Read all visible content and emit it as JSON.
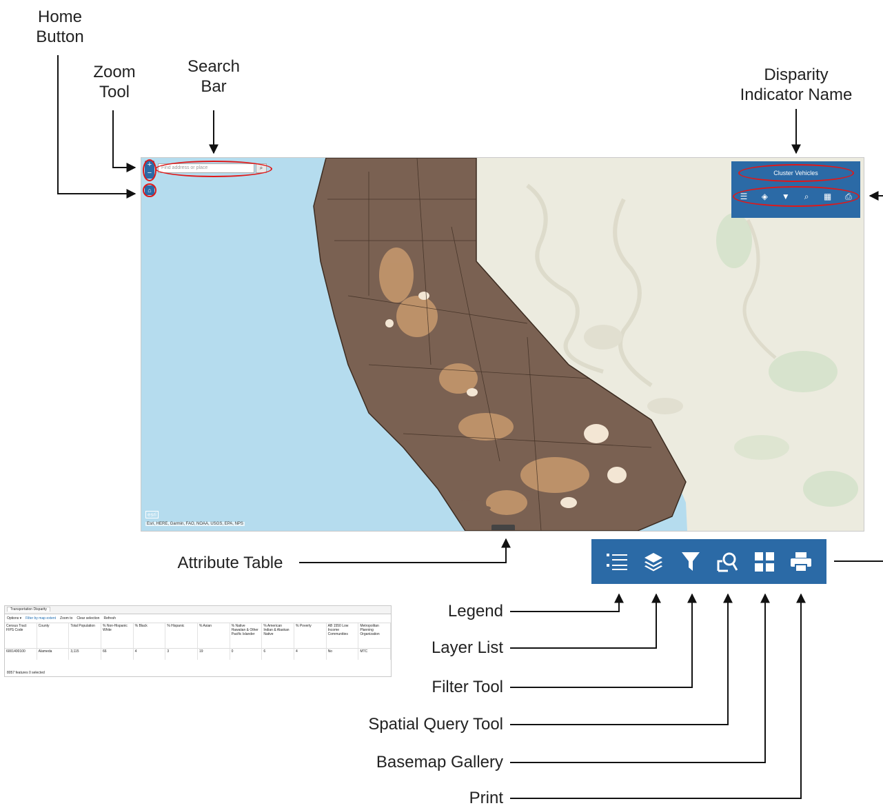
{
  "callouts": {
    "home_button": "Home\nButton",
    "zoom_tool": "Zoom\nTool",
    "search_bar": "Search\nBar",
    "disparity_indicator_name": "Disparity\nIndicator Name",
    "attribute_table": "Attribute Table",
    "legend": "Legend",
    "layer_list": "Layer List",
    "filter_tool": "Filter Tool",
    "spatial_query_tool": "Spatial Query Tool",
    "basemap_gallery": "Basemap Gallery",
    "print": "Print"
  },
  "map": {
    "search_placeholder": "Find address or place",
    "zoom_label": "+\n−",
    "indicator_name": "Cluster Vehicles",
    "attribution": "Esri, HERE, Garmin, FAO, NOAA, USGS, EPA, NPS",
    "logo_text": "esri",
    "colors": {
      "ocean": "#b5dcee",
      "california": "#7a6152",
      "nevada": "#ecebdf",
      "panel": "#2b6aa6",
      "highlight_ring": "#e01818"
    }
  },
  "toolbar_icons": [
    "legend-icon",
    "layer-list-icon",
    "filter-icon",
    "spatial-query-icon",
    "basemap-gallery-icon",
    "print-icon"
  ],
  "attribute_table": {
    "tab_label": "Transportation Disparity",
    "options_label": "Options ▾",
    "filter_label": "Filter by map extent",
    "zoom_label": "Zoom to",
    "clear_label": "Clear selection",
    "refresh_label": "Refresh",
    "columns": [
      "Census Tract FIPS Code",
      "County",
      "Total Population",
      "% Non-Hispanic White",
      "% Black",
      "% Hispanic",
      "% Asian",
      "% Native Hawaiian & Other Pacific Islander",
      "% American Indian & Alaskan Native",
      "% Poverty",
      "AB 1550 Low Income Communities",
      "Metropolitan Planning Organization"
    ],
    "row": [
      "6001400100",
      "Alameda",
      "3,115",
      "66",
      "4",
      "3",
      "19",
      "0",
      "6",
      "4",
      "No",
      "MTC"
    ],
    "status": "8057 features 0 selected"
  }
}
